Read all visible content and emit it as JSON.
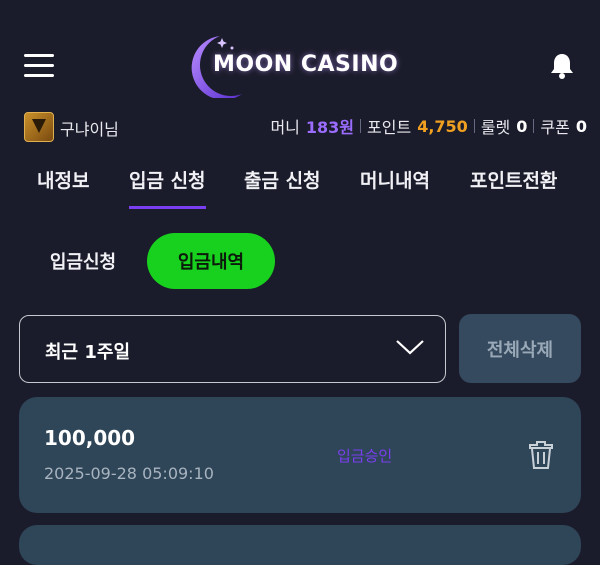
{
  "header": {
    "logo_text": "MOON CASINO",
    "menu_icon": "hamburger-menu-icon",
    "bell_icon": "bell-icon"
  },
  "user": {
    "name": "구냐이님",
    "money_label": "머니",
    "money_value": "183원",
    "point_label": "포인트",
    "point_value": "4,750",
    "roulette_label": "룰렛",
    "roulette_value": "0",
    "coupon_label": "쿠폰",
    "coupon_value": "0"
  },
  "tabs": [
    {
      "label": "내정보"
    },
    {
      "label": "입금 신청"
    },
    {
      "label": "출금 신청"
    },
    {
      "label": "머니내역"
    },
    {
      "label": "포인트전환"
    }
  ],
  "subtabs": [
    {
      "label": "입금신청"
    },
    {
      "label": "입금내역"
    }
  ],
  "filter": {
    "selected": "최근 1주일",
    "delete_all_label": "전체삭제"
  },
  "records": [
    {
      "amount": "100,000",
      "datetime": "2025-09-28 05:09:10",
      "status": "입금승인"
    }
  ],
  "colors": {
    "background": "#1b1c2b",
    "accent_purple": "#7b3ff2",
    "money": "#9a6cff",
    "point": "#f0a020",
    "active_subtab": "#18d11e",
    "card": "#2f4558"
  }
}
